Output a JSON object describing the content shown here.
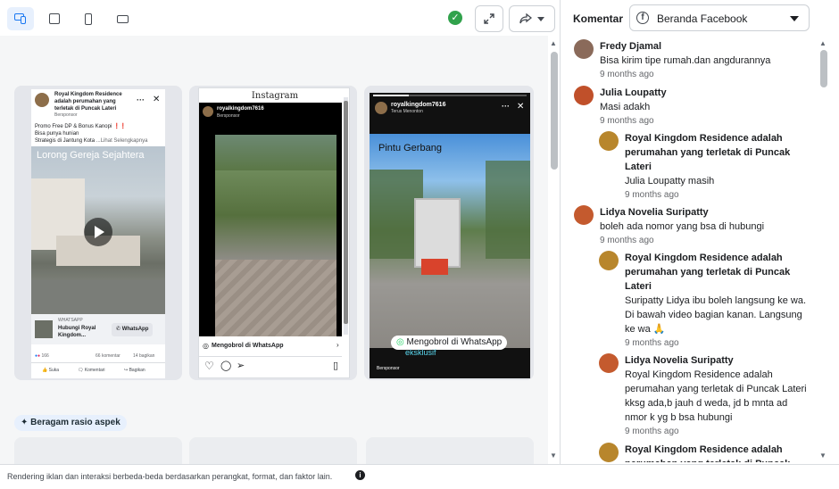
{
  "preview": {
    "facebook": {
      "page_name": "Royal Kingdom Residence adalah perumahan yang terletak di Puncak Lateri",
      "sponsored": "Bersponsor",
      "ad_text_1": "Promo Free DP & Bonus Kanopi",
      "ad_text_2": "Bisa punya hunian",
      "ad_text_3": "Strategis di Jantung Kota",
      "see_more": "...Lihat Selengkapnya",
      "video_caption": "Lorong Gereja Sejahtera",
      "cta_source": "WHATSAPP",
      "cta_headline": "Hubungi Royal Kingdom...",
      "cta_button": "WhatsApp",
      "reaction_count": "166",
      "comment_count": "66 komentar",
      "share_count": "14 bagikan",
      "action_like": "Suka",
      "action_comment": "Komentari",
      "action_share": "Bagikan"
    },
    "instagram": {
      "header": "Instagram",
      "account": "royalkingdom7616",
      "sponsored": "Bersponsor",
      "cta": "Mengobrol di WhatsApp"
    },
    "story": {
      "account": "royalkingdom7616",
      "subtitle": "Terus Menonton",
      "caption": "Pintu Gerbang",
      "cta": "Mengobrol di WhatsApp",
      "sticker": "eksklusif",
      "sponsored": "Bersponsor"
    },
    "aspect_badge": "Beragam rasio aspek"
  },
  "comments_panel": {
    "label": "Komentar",
    "source_select": "Beranda Facebook",
    "items": [
      {
        "name": "Fredy Djamal",
        "text": "Bisa kirim tipe rumah.dan angdurannya",
        "time": "9 months ago",
        "reply": false,
        "avatar_color": "#8a6a5a"
      },
      {
        "name": "Julia Loupatty",
        "text": "Masi adakh",
        "time": "9 months ago",
        "reply": false,
        "avatar_color": "#c0502a"
      },
      {
        "name": "Royal Kingdom Residence adalah perumahan yang terletak di Puncak Lateri",
        "text": "Julia Loupatty masih",
        "time": "9 months ago",
        "reply": true,
        "avatar_color": "#b8862c"
      },
      {
        "name": "Lidya Novelia Suripatty",
        "text": "boleh ada nomor yang bsa di hubungi",
        "time": "9 months ago",
        "reply": false,
        "avatar_color": "#c45a2e"
      },
      {
        "name": "Royal Kingdom Residence adalah perumahan yang terletak di Puncak Lateri",
        "text": "Suripatty Lidya ibu boleh langsung ke wa. Di bawah video bagian kanan. Langsung ke wa 🙏",
        "time": "9 months ago",
        "reply": true,
        "avatar_color": "#b8862c"
      },
      {
        "name": "Lidya Novelia Suripatty",
        "text": "Royal Kingdom Residence adalah perumahan yang terletak di Puncak Lateri kksg ada,b jauh d weda, jd b mnta ad nmor k yg b bsa hubungi",
        "time": "9 months ago",
        "reply": true,
        "avatar_color": "#c45a2e"
      },
      {
        "name": "Royal Kingdom Residence adalah perumahan yang terletak di Puncak Lateri",
        "text": "",
        "time": "",
        "reply": true,
        "avatar_color": "#b8862c"
      }
    ]
  },
  "footer": {
    "text": "Rendering iklan dan interaksi berbeda-beda berdasarkan perangkat, format, dan faktor lain."
  }
}
